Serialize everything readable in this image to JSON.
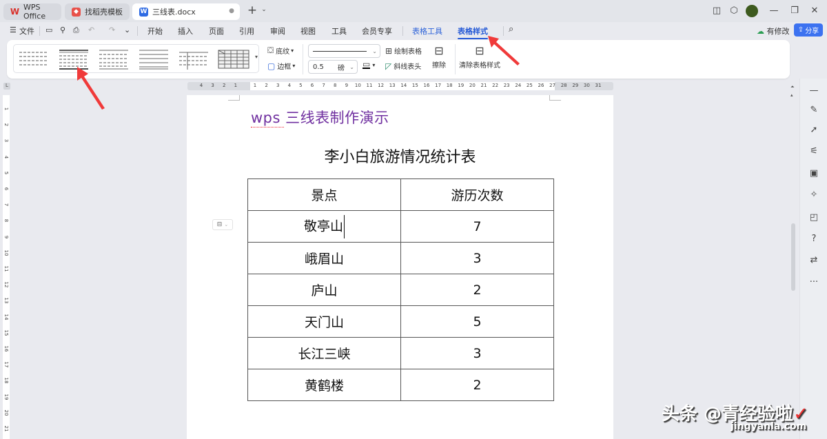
{
  "titlebar": {
    "tabs": [
      {
        "label": "WPS Office",
        "icon": "wps-logo-icon",
        "active": false
      },
      {
        "label": "找稻壳模板",
        "icon": "docer-icon",
        "active": false
      },
      {
        "label": "三线表.docx",
        "icon": "word-doc-icon",
        "active": true
      }
    ],
    "new_tab": "+",
    "win_controls": [
      "sidebar-toggle-icon",
      "cube-icon",
      "avatar",
      "minimize-icon",
      "restore-icon",
      "close-icon"
    ]
  },
  "menubar": {
    "file_label": "文件",
    "items": [
      "开始",
      "插入",
      "页面",
      "引用",
      "审阅",
      "视图",
      "工具",
      "会员专享"
    ],
    "context_tabs": [
      "表格工具",
      "表格样式"
    ],
    "active_tab": "表格样式",
    "modified_label": "有修改",
    "share_label": "分享"
  },
  "ribbon": {
    "style_gallery_count": 6,
    "shading_label": "底纹",
    "border_label": "边框",
    "line_weight_value": "0.5",
    "line_weight_unit": "磅",
    "draw_table_label": "绘制表格",
    "diagonal_header_label": "斜线表头",
    "erase_label": "擦除",
    "clear_style_label": "清除表格样式"
  },
  "ruler": {
    "horizontal_left": [
      "4",
      "3",
      "2",
      "1"
    ],
    "horizontal": [
      "1",
      "2",
      "3",
      "4",
      "5",
      "6",
      "7",
      "8",
      "9",
      "10",
      "11",
      "12",
      "13",
      "14",
      "15",
      "16",
      "17",
      "18",
      "19",
      "20",
      "21",
      "22",
      "23",
      "24",
      "25",
      "26",
      "27",
      "28",
      "29",
      "30",
      "31"
    ],
    "vertical": [
      "1",
      "2",
      "3",
      "4",
      "5",
      "6",
      "7",
      "8",
      "9",
      "10",
      "11",
      "12",
      "13",
      "14",
      "15",
      "16",
      "17",
      "18",
      "19",
      "20",
      "21"
    ]
  },
  "document": {
    "heading": "wps 三线表制作演示",
    "table_title": "李小白旅游情况统计表",
    "table": {
      "headers": [
        "景点",
        "游历次数"
      ],
      "rows": [
        [
          "敬亭山",
          "7"
        ],
        [
          "峨眉山",
          "3"
        ],
        [
          "庐山",
          "2"
        ],
        [
          "天门山",
          "5"
        ],
        [
          "长江三峡",
          "3"
        ],
        [
          "黄鹤楼",
          "2"
        ]
      ]
    }
  },
  "watermark": {
    "text": "头条 @青经验啦",
    "sub": "jingyanla.com"
  },
  "colors": {
    "accent": "#2459d6",
    "heading": "#7030a0",
    "arrow": "#f03a3a"
  }
}
